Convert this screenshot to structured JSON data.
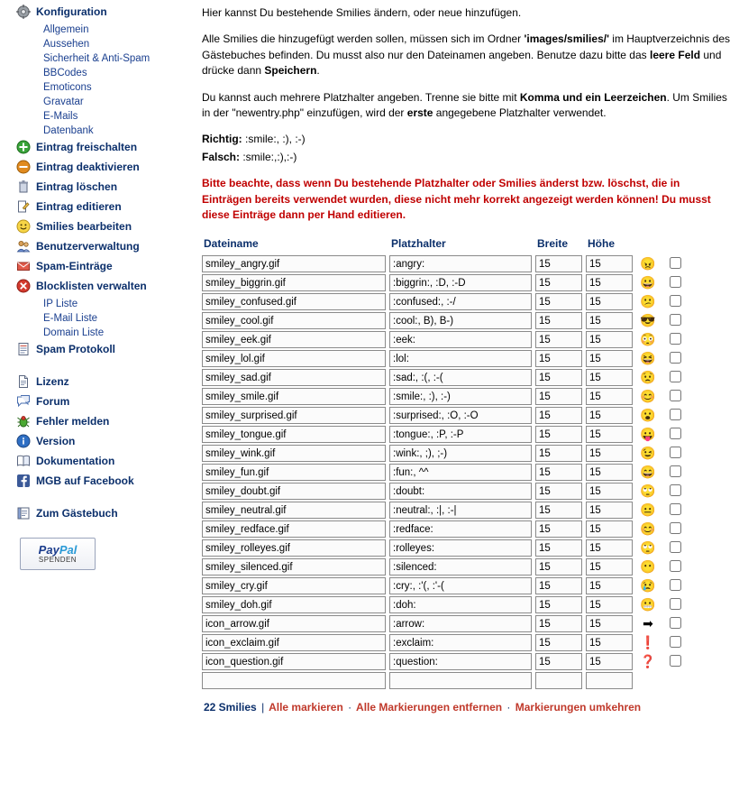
{
  "sidebar": {
    "config": {
      "label": "Konfiguration",
      "icon": "gear-icon"
    },
    "config_subitems": [
      {
        "label": "Allgemein"
      },
      {
        "label": "Aussehen"
      },
      {
        "label": "Sicherheit & Anti-Spam"
      },
      {
        "label": "BBCodes"
      },
      {
        "label": "Emoticons"
      },
      {
        "label": "Gravatar"
      },
      {
        "label": "E-Mails"
      },
      {
        "label": "Datenbank"
      }
    ],
    "items": [
      {
        "label": "Eintrag freischalten",
        "icon": "green-plus-icon"
      },
      {
        "label": "Eintrag deaktivieren",
        "icon": "orange-minus-icon"
      },
      {
        "label": "Eintrag löschen",
        "icon": "trash-icon"
      },
      {
        "label": "Eintrag editieren",
        "icon": "edit-icon"
      },
      {
        "label": "Smilies bearbeiten",
        "icon": "smiley-icon"
      },
      {
        "label": "Benutzerverwaltung",
        "icon": "users-icon"
      },
      {
        "label": "Spam-Einträge",
        "icon": "spam-icon"
      },
      {
        "label": "Blocklisten verwalten",
        "icon": "block-icon"
      }
    ],
    "block_subitems": [
      {
        "label": "IP Liste"
      },
      {
        "label": "E-Mail Liste"
      },
      {
        "label": "Domain Liste"
      }
    ],
    "spam_protokoll": {
      "label": "Spam Protokoll",
      "icon": "log-icon"
    },
    "items2": [
      {
        "label": "Lizenz",
        "icon": "document-icon"
      },
      {
        "label": "Forum",
        "icon": "forum-icon"
      },
      {
        "label": "Fehler melden",
        "icon": "bug-icon"
      },
      {
        "label": "Version",
        "icon": "info-icon"
      },
      {
        "label": "Dokumentation",
        "icon": "book-icon"
      },
      {
        "label": "MGB auf Facebook",
        "icon": "facebook-icon"
      }
    ],
    "guestbook": {
      "label": "Zum Gästebuch",
      "icon": "guestbook-icon"
    },
    "paypal": {
      "line1a": "Pay",
      "line1b": "Pal",
      "line2": "SPENDEN"
    }
  },
  "main": {
    "intro1": "Hier kannst Du bestehende Smilies ändern, oder neue hinzufügen.",
    "intro2_a": "Alle Smilies die hinzugefügt werden sollen, müssen sich im Ordner ",
    "intro2_b": "'images/smilies/'",
    "intro2_c": " im Hauptverzeichnis des Gästebuches befinden. Du musst also nur den Dateinamen angeben. Benutze dazu bitte das ",
    "intro2_d": "leere Feld",
    "intro2_e": " und drücke dann ",
    "intro2_f": "Speichern",
    "intro2_g": ".",
    "intro3_a": "Du kannst auch mehrere Platzhalter angeben. Trenne sie bitte mit ",
    "intro3_b": "Komma und ein Leerzeichen",
    "intro3_c": ". Um Smilies in der \"newentry.php\" einzufügen, wird der ",
    "intro3_d": "erste",
    "intro3_e": " angegebene Platzhalter verwendet.",
    "richtig_label": "Richtig:",
    "richtig_value": " :smile:, :), :-)",
    "falsch_label": "Falsch:",
    "falsch_value": " :smile:,:),:-)",
    "warning": "Bitte beachte, dass wenn Du bestehende Platzhalter oder Smilies änderst bzw. löschst, die in Einträgen bereits verwendet wurden, diese nicht mehr korrekt angezeigt werden können! Du musst diese Einträge dann per Hand editieren.",
    "headers": {
      "dateiname": "Dateiname",
      "platzhalter": "Platzhalter",
      "breite": "Breite",
      "hoehe": "Höhe"
    },
    "rows": [
      {
        "file": "smiley_angry.gif",
        "placeholder": ":angry:",
        "width": "15",
        "height": "15",
        "emoji": "😠",
        "checked": false
      },
      {
        "file": "smiley_biggrin.gif",
        "placeholder": ":biggrin:, :D, :-D",
        "width": "15",
        "height": "15",
        "emoji": "😀",
        "checked": false
      },
      {
        "file": "smiley_confused.gif",
        "placeholder": ":confused:, :-/",
        "width": "15",
        "height": "15",
        "emoji": "😕",
        "checked": false
      },
      {
        "file": "smiley_cool.gif",
        "placeholder": ":cool:, B), B-)",
        "width": "15",
        "height": "15",
        "emoji": "😎",
        "checked": false
      },
      {
        "file": "smiley_eek.gif",
        "placeholder": ":eek:",
        "width": "15",
        "height": "15",
        "emoji": "😳",
        "checked": false
      },
      {
        "file": "smiley_lol.gif",
        "placeholder": ":lol:",
        "width": "15",
        "height": "15",
        "emoji": "😆",
        "checked": false
      },
      {
        "file": "smiley_sad.gif",
        "placeholder": ":sad:, :(, :-(",
        "width": "15",
        "height": "15",
        "emoji": "😟",
        "checked": false
      },
      {
        "file": "smiley_smile.gif",
        "placeholder": ":smile:, :), :-)",
        "width": "15",
        "height": "15",
        "emoji": "😊",
        "checked": false
      },
      {
        "file": "smiley_surprised.gif",
        "placeholder": ":surprised:, :O, :-O",
        "width": "15",
        "height": "15",
        "emoji": "😮",
        "checked": false
      },
      {
        "file": "smiley_tongue.gif",
        "placeholder": ":tongue:, :P, :-P",
        "width": "15",
        "height": "15",
        "emoji": "😛",
        "checked": false
      },
      {
        "file": "smiley_wink.gif",
        "placeholder": ":wink:, ;), ;-)",
        "width": "15",
        "height": "15",
        "emoji": "😉",
        "checked": false
      },
      {
        "file": "smiley_fun.gif",
        "placeholder": ":fun:, ^^",
        "width": "15",
        "height": "15",
        "emoji": "😄",
        "checked": false
      },
      {
        "file": "smiley_doubt.gif",
        "placeholder": ":doubt:",
        "width": "15",
        "height": "15",
        "emoji": "🙄",
        "checked": false
      },
      {
        "file": "smiley_neutral.gif",
        "placeholder": ":neutral:, :|, :-|",
        "width": "15",
        "height": "15",
        "emoji": "😐",
        "checked": false
      },
      {
        "file": "smiley_redface.gif",
        "placeholder": ":redface:",
        "width": "15",
        "height": "15",
        "emoji": "😊",
        "checked": false
      },
      {
        "file": "smiley_rolleyes.gif",
        "placeholder": ":rolleyes:",
        "width": "15",
        "height": "15",
        "emoji": "🙄",
        "checked": false
      },
      {
        "file": "smiley_silenced.gif",
        "placeholder": ":silenced:",
        "width": "15",
        "height": "15",
        "emoji": "😶",
        "checked": false
      },
      {
        "file": "smiley_cry.gif",
        "placeholder": ":cry:, :'(, :'-(",
        "width": "15",
        "height": "15",
        "emoji": "😢",
        "checked": false
      },
      {
        "file": "smiley_doh.gif",
        "placeholder": ":doh:",
        "width": "15",
        "height": "15",
        "emoji": "😬",
        "checked": false
      },
      {
        "file": "icon_arrow.gif",
        "placeholder": ":arrow:",
        "width": "15",
        "height": "15",
        "emoji": "➡",
        "checked": false
      },
      {
        "file": "icon_exclaim.gif",
        "placeholder": ":exclaim:",
        "width": "15",
        "height": "15",
        "emoji": "❗",
        "checked": false
      },
      {
        "file": "icon_question.gif",
        "placeholder": ":question:",
        "width": "15",
        "height": "15",
        "emoji": "❓",
        "checked": false
      },
      {
        "file": "",
        "placeholder": "",
        "width": "",
        "height": "",
        "emoji": "",
        "checked": false
      }
    ],
    "footer": {
      "count": "22 Smilies",
      "sep1": "|",
      "select_all": "Alle markieren",
      "dot1": "·",
      "deselect_all": "Alle Markierungen entfernen",
      "dot2": "·",
      "invert": "Markierungen umkehren"
    }
  },
  "colors": {
    "link": "#1a3f8f",
    "heading": "#0b2f6b",
    "warning": "#c00000",
    "ok": "#2e8b22",
    "bad": "#d47b1a",
    "footer_link": "#c0392b"
  }
}
